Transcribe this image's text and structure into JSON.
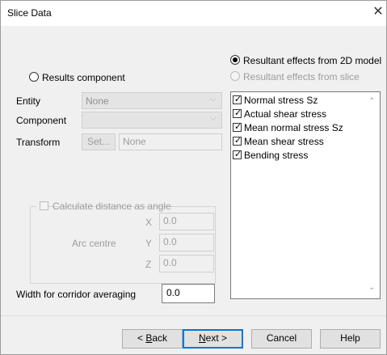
{
  "window": {
    "title": "Slice Data",
    "close_glyph": "✕"
  },
  "source_options": {
    "results_component": {
      "label": "Results component",
      "selected": false,
      "enabled": true
    },
    "resultant_2d": {
      "label": "Resultant effects from 2D model",
      "selected": true,
      "enabled": true
    },
    "resultant_slice": {
      "label": "Resultant effects from slice",
      "selected": false,
      "enabled": false
    }
  },
  "form": {
    "entity": {
      "label": "Entity",
      "value": "None"
    },
    "component": {
      "label": "Component",
      "value": ""
    },
    "transform": {
      "label": "Transform",
      "button_label": "Set...",
      "value": "None"
    }
  },
  "effects_list": {
    "items": [
      {
        "label": "Normal stress Sz",
        "checked": true
      },
      {
        "label": "Actual shear stress",
        "checked": true
      },
      {
        "label": "Mean normal stress Sz",
        "checked": true
      },
      {
        "label": "Mean shear stress",
        "checked": true
      },
      {
        "label": "Bending stress",
        "checked": true
      }
    ]
  },
  "distance_group": {
    "checkbox_label": "Calculate distance as angle",
    "checked": false,
    "arc_centre_label": "Arc centre",
    "x_label": "X",
    "x_value": "0.0",
    "y_label": "Y",
    "y_value": "0.0",
    "z_label": "Z",
    "z_value": "0.0"
  },
  "corridor": {
    "label": "Width for corridor averaging",
    "value": "0.0"
  },
  "buttons": {
    "back": {
      "prefix": "< ",
      "mnemonic": "B",
      "rest": "ack"
    },
    "next": {
      "mnemonic": "N",
      "rest": "ext >"
    },
    "cancel": "Cancel",
    "help": "Help"
  },
  "icons": {
    "check_glyph": "✓",
    "dropdown_glyph": "⌵",
    "scroll_up_glyph": "⌃",
    "scroll_down_glyph": "⌄"
  }
}
